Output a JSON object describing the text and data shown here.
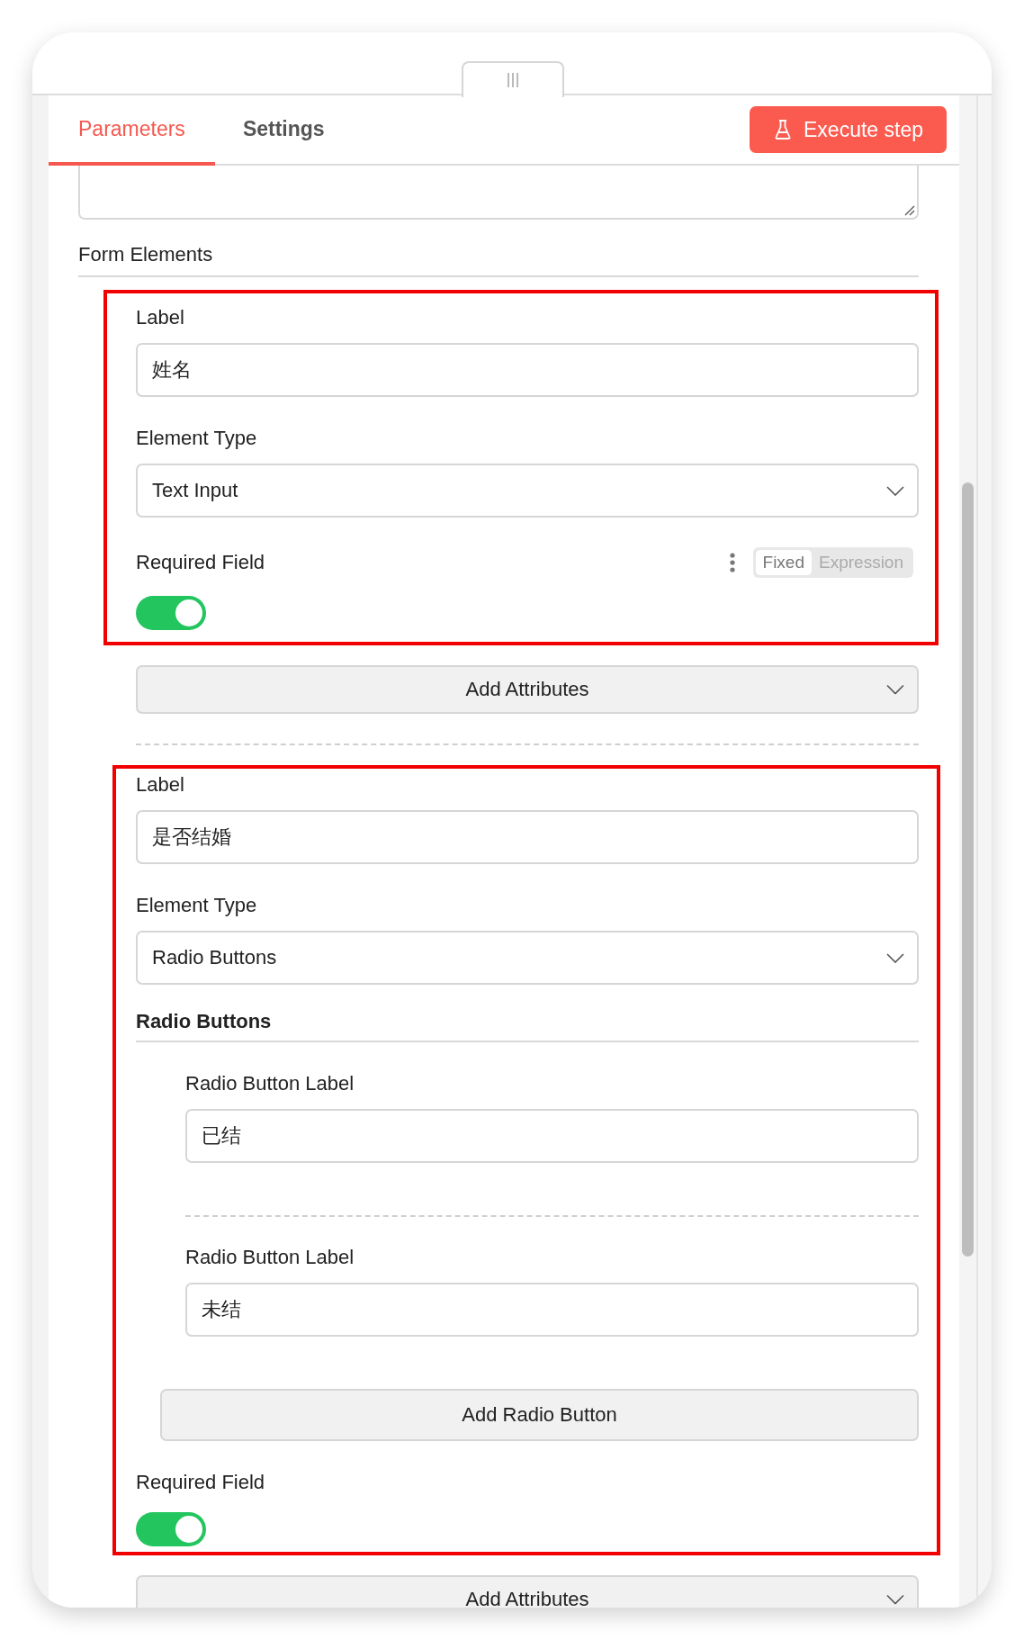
{
  "header": {
    "tabs": [
      {
        "label": "Parameters",
        "selected": true
      },
      {
        "label": "Settings",
        "selected": false
      }
    ],
    "execute_button": "Execute step"
  },
  "form_elements": {
    "title": "Form Elements",
    "elements": [
      {
        "highlighted": true,
        "label_caption": "Label",
        "label_value": "姓名",
        "type_caption": "Element Type",
        "type_value": "Text Input",
        "required_caption": "Required Field",
        "required": true,
        "mode_toggle": [
          {
            "label": "Fixed",
            "selected": true
          },
          {
            "label": "Expression",
            "selected": false
          }
        ],
        "add_attributes": "Add Attributes"
      },
      {
        "highlighted": true,
        "label_caption": "Label",
        "label_value": "是否结婚",
        "type_caption": "Element Type",
        "type_value": "Radio Buttons",
        "radio_section": {
          "title": "Radio Buttons",
          "options": [
            {
              "caption": "Radio Button Label",
              "value": "已结"
            },
            {
              "caption": "Radio Button Label",
              "value": "未结"
            }
          ],
          "add_button": "Add Radio Button"
        },
        "required_caption": "Required Field",
        "required": true,
        "add_attributes": "Add Attributes"
      }
    ]
  }
}
